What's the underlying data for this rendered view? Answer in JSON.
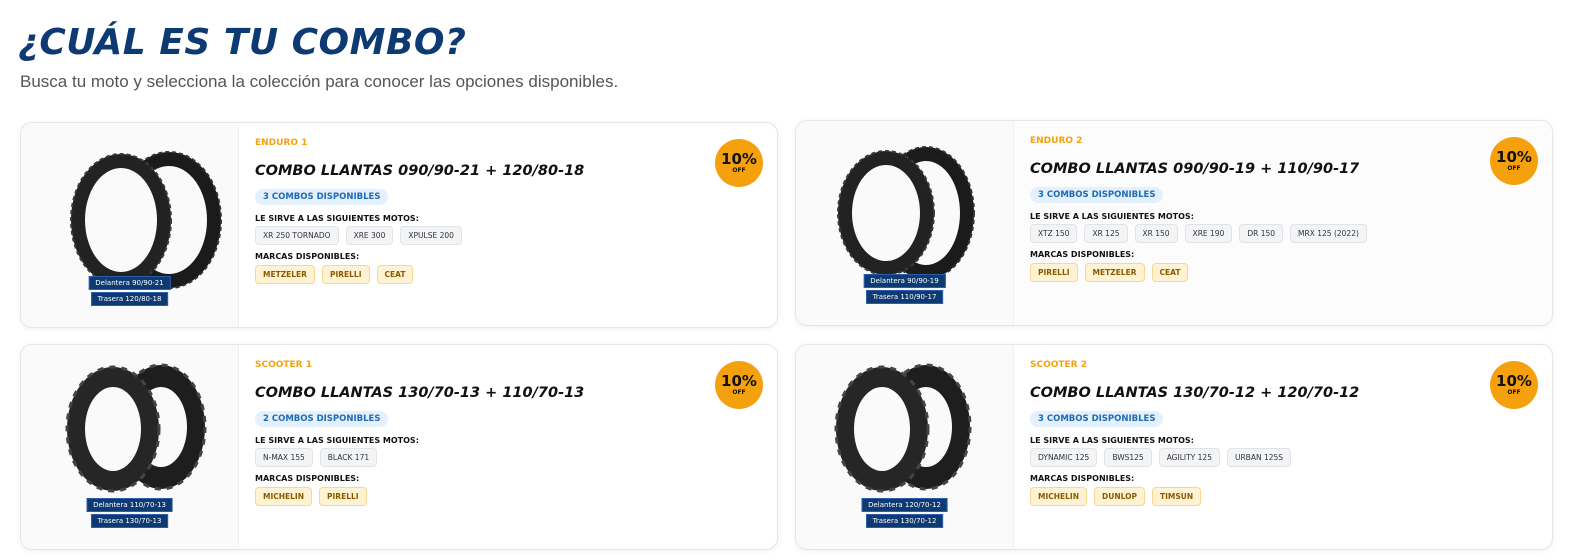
{
  "header": {
    "title": "¿CUÁL ES TU COMBO?",
    "subtitle": "Busca tu moto y selecciona la colección para conocer las opciones disponibles."
  },
  "labels": {
    "motos": "LE SIRVE A LAS SIGUIENTES MOTOS:",
    "marcas": "MARCAS DISPONIBLES:",
    "off": "OFF"
  },
  "colors": {
    "brand_navy": "#0e3a73",
    "accent_orange": "#f5a00d",
    "pill_blue": "#1d6bb8"
  },
  "cards": [
    {
      "collection": "ENDURO 1",
      "title": "COMBO LLANTAS 090/90-21 + 120/80-18",
      "available": "3 COMBOS DISPONIBLES",
      "discount": "10%",
      "front_tag": "Delantera 90/90-21",
      "rear_tag": "Trasera 120/80-18",
      "image_icon": "enduro-tires-icon",
      "motos": [
        "XR 250 TORNADO",
        "XRE 300",
        "XPULSE 200"
      ],
      "brands": [
        "METZELER",
        "PIRELLI",
        "CEAT"
      ]
    },
    {
      "collection": "ENDURO 2",
      "title": "COMBO LLANTAS 090/90-19 + 110/90-17",
      "available": "3 COMBOS DISPONIBLES",
      "discount": "10%",
      "front_tag": "Delantera 90/90-19",
      "rear_tag": "Trasera 110/90-17",
      "image_icon": "enduro-tires-icon",
      "motos": [
        "XTZ 150",
        "XR 125",
        "XR 150",
        "XRE 190",
        "DR 150",
        "MRX 125 (2022)"
      ],
      "brands": [
        "PIRELLI",
        "METZELER",
        "CEAT"
      ]
    },
    {
      "collection": "SCOOTER 1",
      "title": "COMBO LLANTAS 130/70-13 + 110/70-13",
      "available": "2 COMBOS DISPONIBLES",
      "discount": "10%",
      "front_tag": "Delantera 110/70-13",
      "rear_tag": "Trasera 130/70-13",
      "image_icon": "scooter-tires-icon",
      "motos": [
        "N-MAX 155",
        "BLACK 171"
      ],
      "brands": [
        "MICHELIN",
        "PIRELLI"
      ]
    },
    {
      "collection": "SCOOTER 2",
      "title": "COMBO LLANTAS 130/70-12 + 120/70-12",
      "available": "3 COMBOS DISPONIBLES",
      "discount": "10%",
      "front_tag": "Delantera 120/70-12",
      "rear_tag": "Trasera 130/70-12",
      "image_icon": "scooter-tires-icon",
      "motos": [
        "DYNAMIC 125",
        "BWS125",
        "AGILITY 125",
        "URBAN 125S"
      ],
      "brands": [
        "MICHELIN",
        "DUNLOP",
        "TIMSUN"
      ]
    }
  ]
}
